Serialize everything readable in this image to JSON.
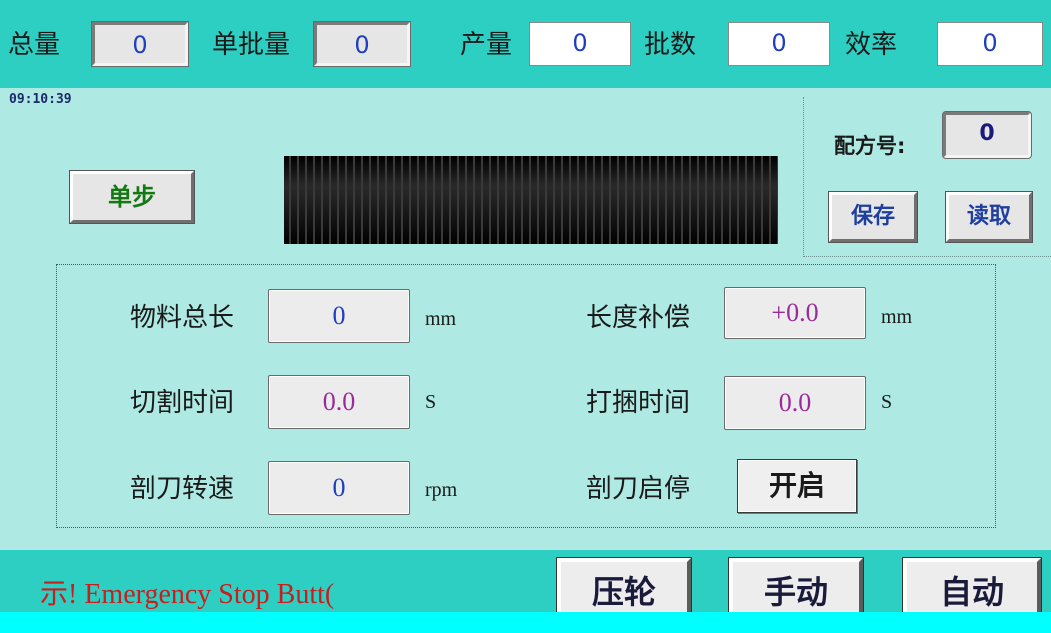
{
  "top": {
    "total_label": "总量",
    "total_value": "0",
    "batch_size_label": "单批量",
    "batch_size_value": "0",
    "output_label": "产量",
    "output_value": "0",
    "batch_count_label": "批数",
    "batch_count_value": "0",
    "efficiency_label": "效率",
    "efficiency_value": "0"
  },
  "clock": "09:10:39",
  "single_step_label": "单步",
  "recipe": {
    "label": "配方号:",
    "value": "0",
    "save_label": "保存",
    "read_label": "读取"
  },
  "params": {
    "material_length": {
      "label": "物料总长",
      "value": "0",
      "unit": "mm"
    },
    "length_comp": {
      "label": "长度补偿",
      "value": "+0.0",
      "unit": "mm"
    },
    "cut_time": {
      "label": "切割时间",
      "value": "0.0",
      "unit": "S"
    },
    "bundle_time": {
      "label": "打捆时间",
      "value": "0.0",
      "unit": "S"
    },
    "blade_speed": {
      "label": "剖刀转速",
      "value": "0",
      "unit": "rpm"
    },
    "blade_start_stop": {
      "label": "剖刀启停",
      "button": "开启"
    }
  },
  "bottom": {
    "ticker_text": "示! Emergency Stop Butt(",
    "press_wheel_label": "压轮",
    "manual_label": "手动",
    "auto_label": "自动"
  },
  "colors": {
    "header_bg": "#2ecfc3",
    "panel_bg": "#aee9e3",
    "magenta_value": "#9a2a9a",
    "blue_value": "#1f3fbf",
    "alarm_text": "#c81e1e",
    "green_text": "#137a13"
  }
}
